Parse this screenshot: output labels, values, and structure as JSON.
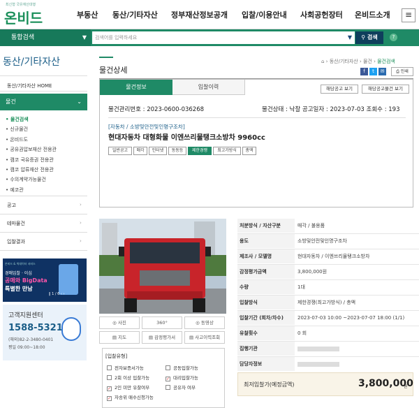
{
  "logo": {
    "sub": "최신형 국유재산대행",
    "main": "온비드"
  },
  "gnb": [
    "부동산",
    "동산/기타자산",
    "정부재산정보공개",
    "입찰/이용안내",
    "사회공헌장터",
    "온비드소개"
  ],
  "search": {
    "category": "통합검색",
    "placeholder": "검색어를 입력하세요",
    "button": "검색"
  },
  "sidebar": {
    "title": "동산/기타자산",
    "home": "동산/기타자산 HOME",
    "active": "물건",
    "subs": [
      "물건검색",
      "신규물건",
      "온비드도",
      "공유권압보재산 전용관",
      "캠코 국유증권 전용관",
      "캠코 압류재산 전용관",
      "수의계약가능물건",
      "예코관"
    ],
    "items": [
      "공고",
      "테마물건",
      "입찰결과"
    ]
  },
  "banner": {
    "l1": "온비드 & 빅데이터 서비스",
    "l2": "경매입찰 · 이심",
    "l3": "공매와 BigData",
    "l4": "특별한 만남",
    "pager": "1 / 6"
  },
  "center": {
    "title": "고객지원센터",
    "phone": "1588-5321",
    "overseas": "(해외)82-2-3480-0401",
    "hours": "평일 09:00~18:00"
  },
  "page": {
    "title": "물건상세",
    "crumb": [
      "동산/기타자산",
      "물건",
      "물건검색"
    ],
    "print": "인쇄"
  },
  "tabs": {
    "info": "물건정보",
    "history": "입찰이력",
    "notice_btn": "해당공고 보기",
    "other_btn": "해당공고물건 보기"
  },
  "item": {
    "mgmt": "물건관리번호 : 2023-0600-036268",
    "status": "물건상태 : 낙찰   공고일자 : 2023-07-03   조회수 : 193",
    "category": "[자동차 / 소방및안전및인명구조차]",
    "name": "현대자동차 대형화물 이엔쓰리물탱크소방차 9960cc",
    "tags": [
      "일반공고",
      "매각",
      "인터넷",
      "동동등",
      "제한경쟁",
      "최고가방식",
      "총액"
    ]
  },
  "photo_buttons": [
    "사진",
    "360°",
    "동영상",
    "지도",
    "감정평가서",
    "사고이력조회"
  ],
  "bid_types": {
    "title": "[입찰유형]",
    "options": [
      {
        "label": "전자보증서가능",
        "checked": false
      },
      {
        "label": "공동입찰가능",
        "checked": false
      },
      {
        "label": "2회 이상 입찰가능",
        "checked": false
      },
      {
        "label": "대리입찰가능",
        "checked": true
      },
      {
        "label": "2인 미만 유찰여부",
        "checked": true
      },
      {
        "label": "공유자 여부",
        "checked": false
      },
      {
        "label": "자송위 매수신청가능",
        "checked": true
      }
    ]
  },
  "details": [
    {
      "label": "처분방식 / 자산구분",
      "value": "매각 / 불용품"
    },
    {
      "label": "용도",
      "value": "소방및안전및인명구조차"
    },
    {
      "label": "제조사 / 모델명",
      "value": "현대자동차 / 이엔쓰리물탱크소방차"
    },
    {
      "label": "감정평가금액",
      "value": "3,800,000원"
    },
    {
      "label": "수량",
      "value": "1대"
    },
    {
      "label": "입찰방식",
      "value": "제한경쟁(최고가방식) / 총액"
    },
    {
      "label": "입찰기간 (회차/차수)",
      "value": "2023-07-03 10:00 ~2023-07-07 18:00 (1/1)"
    },
    {
      "label": "유찰횟수",
      "value": "0 회"
    },
    {
      "label": "집행기관",
      "value": ""
    },
    {
      "label": "담당자정보",
      "value": ""
    }
  ],
  "price": {
    "label": "최저입찰가(예정금액)",
    "value": "3,800,000",
    "unit": "원"
  }
}
